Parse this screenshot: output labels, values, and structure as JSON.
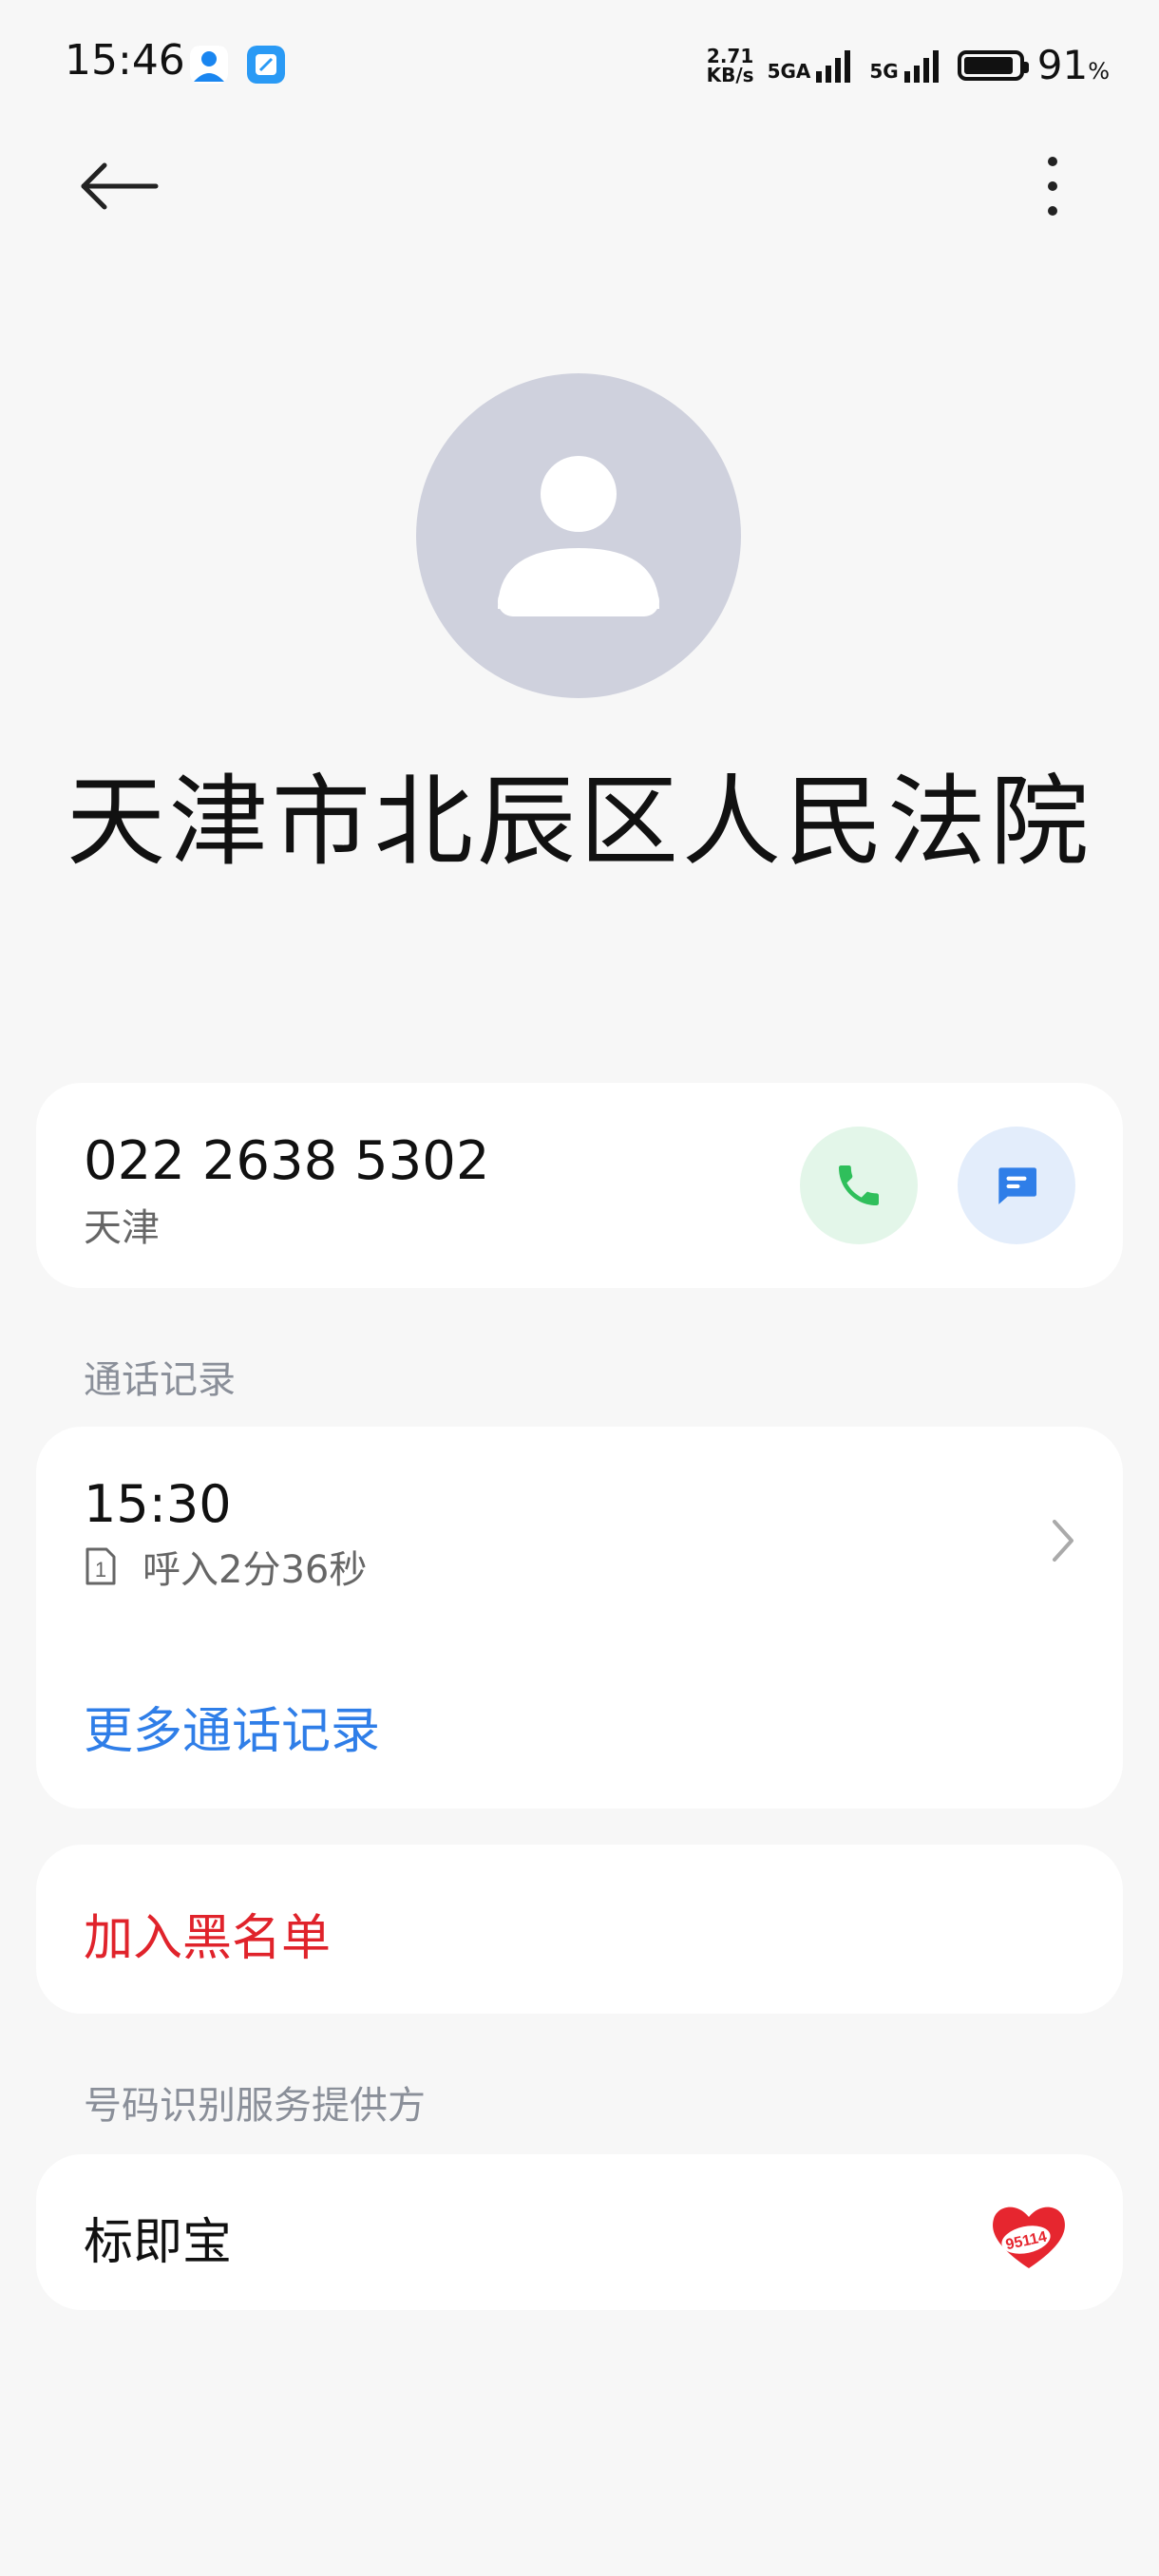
{
  "status_bar": {
    "time": "15:46",
    "net_speed_value": "2.71",
    "net_speed_unit": "KB/s",
    "sim1_label": "5GA",
    "sim2_label": "5G",
    "battery_percent": "91",
    "battery_percent_sign": "%",
    "battery_level": 0.91
  },
  "contact": {
    "name": "天津市北辰区人民法院",
    "phone_number": "022 2638 5302",
    "location": "天津"
  },
  "call_log": {
    "section_label": "通话记录",
    "entries": [
      {
        "time": "15:30",
        "sim_slot": "1",
        "detail": "呼入2分36秒"
      }
    ],
    "more_label": "更多通话记录"
  },
  "block": {
    "label": "加入黑名单"
  },
  "provider": {
    "section_label": "号码识别服务提供方",
    "name": "标即宝",
    "logo_text": "95114"
  },
  "colors": {
    "accent_blue": "#2f7ee8",
    "danger_red": "#e0232b",
    "call_green": "#2fbf5b",
    "avatar_gray": "#cfd1dd"
  },
  "icons": {
    "back": "arrow-left-icon",
    "more": "more-vertical-icon",
    "call": "phone-icon",
    "message": "message-icon",
    "chevron": "chevron-right-icon"
  }
}
